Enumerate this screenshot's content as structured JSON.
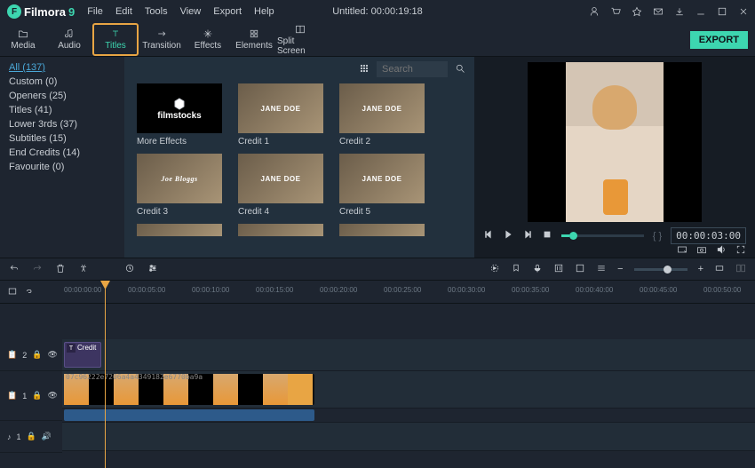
{
  "app": {
    "name": "Filmora",
    "version": "9"
  },
  "menu": [
    "File",
    "Edit",
    "Tools",
    "View",
    "Export",
    "Help"
  ],
  "title": "Untitled:  00:00:19:18",
  "export_label": "EXPORT",
  "tabs": [
    {
      "label": "Media",
      "icon": "folder"
    },
    {
      "label": "Audio",
      "icon": "music"
    },
    {
      "label": "Titles",
      "icon": "text",
      "active": true
    },
    {
      "label": "Transition",
      "icon": "transition"
    },
    {
      "label": "Effects",
      "icon": "sparkle"
    },
    {
      "label": "Elements",
      "icon": "elements"
    },
    {
      "label": "Split Screen",
      "icon": "split"
    }
  ],
  "sidebar": {
    "items": [
      {
        "label": "All (137)",
        "all": true
      },
      {
        "label": "Custom (0)"
      },
      {
        "label": "Openers (25)"
      },
      {
        "label": "Titles (41)"
      },
      {
        "label": "Lower 3rds (37)"
      },
      {
        "label": "Subtitles (15)"
      },
      {
        "label": "End Credits (14)"
      },
      {
        "label": "Favourite (0)"
      }
    ]
  },
  "search": {
    "placeholder": "Search"
  },
  "thumbs": {
    "row1": [
      {
        "label": "More Effects",
        "brand": "filmstocks"
      },
      {
        "label": "Credit 1",
        "name": "JANE DOE"
      },
      {
        "label": "Credit 2",
        "name": "JANE DOE"
      }
    ],
    "row2": [
      {
        "label": "Credit 3",
        "name": "Joe Bloggs"
      },
      {
        "label": "Credit 4",
        "name": "JANE DOE"
      },
      {
        "label": "Credit 5",
        "name": "JANE DOE"
      }
    ]
  },
  "preview": {
    "timecode": "00:00:03:00",
    "markers": "{   }"
  },
  "ruler": [
    "00:00:00:00",
    "00:00:05:00",
    "00:00:10:00",
    "00:00:15:00",
    "00:00:20:00",
    "00:00:25:00",
    "00:00:30:00",
    "00:00:35:00",
    "00:00:40:00",
    "00:00:45:00",
    "00:00:50:00"
  ],
  "tracks": {
    "title": {
      "name": "Credit"
    },
    "video": {
      "name": "07c96222e7206a4a4349182e6770ba9a"
    },
    "heads": {
      "t2": "2",
      "t1": "1",
      "a1": "1"
    }
  }
}
